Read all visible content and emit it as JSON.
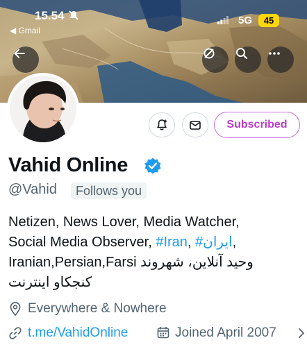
{
  "status_bar": {
    "time": "15.54",
    "back_app": "◀ Gmail",
    "network": "5G",
    "battery": "45"
  },
  "profile": {
    "display_name": "Vahid Online",
    "handle": "@Vahid",
    "follows_you": "Follows you",
    "subscribe_label": "Subscribed",
    "bio": {
      "line1": "Netizen, News Lover, Media Watcher,",
      "line2_text": "Social Media Observer, ",
      "tag_iran": "#Iran",
      "line2_sep": ", ",
      "tag_iran_fa": "ایران#",
      "line2_end": ",",
      "line3": "Iranian,Persian,Farsi وحید آنلاین، شهروند",
      "line4": "کنجکاو اینترنت"
    },
    "location": "Everywhere & Nowhere",
    "website": "t.me/VahidOnline",
    "joined": "Joined April 2007"
  },
  "colors": {
    "accent": "#1d9bf0",
    "subscribe": "#b93ec7",
    "verified": "#1d9bf0",
    "muted": "#536471"
  }
}
